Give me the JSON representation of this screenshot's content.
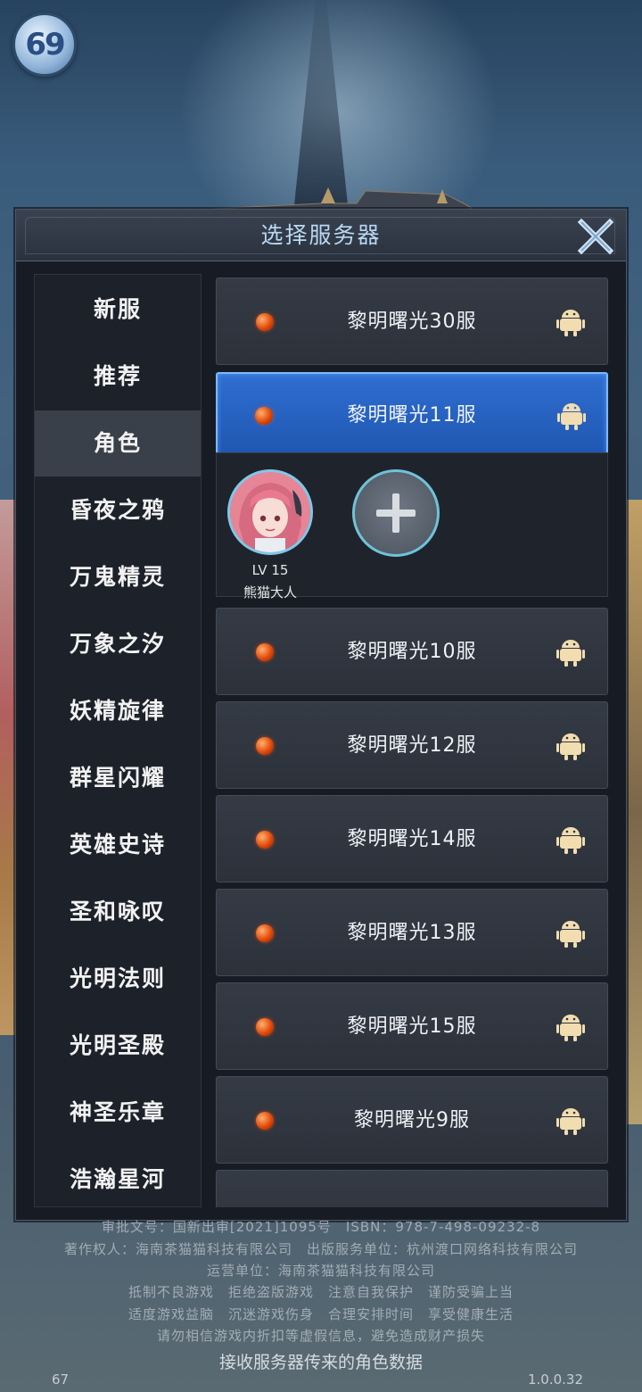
{
  "logo": {
    "text": "69"
  },
  "dialog": {
    "title": "选择服务器",
    "close_icon": "close-x-icon"
  },
  "sidebar": {
    "items": [
      {
        "label": "新服"
      },
      {
        "label": "推荐"
      },
      {
        "label": "角色",
        "active": true
      },
      {
        "label": "昏夜之鸦"
      },
      {
        "label": "万鬼精灵"
      },
      {
        "label": "万象之汐"
      },
      {
        "label": "妖精旋律"
      },
      {
        "label": "群星闪耀"
      },
      {
        "label": "英雄史诗"
      },
      {
        "label": "圣和咏叹"
      },
      {
        "label": "光明法则"
      },
      {
        "label": "光明圣殿"
      },
      {
        "label": "神圣乐章"
      },
      {
        "label": "浩瀚星河"
      }
    ]
  },
  "servers": [
    {
      "name": "黎明曙光30服",
      "status_color": "#e24a0a",
      "platform_icon": "android-icon"
    },
    {
      "name": "黎明曙光11服",
      "status_color": "#e24a0a",
      "platform_icon": "android-icon",
      "selected": true
    },
    {
      "name": "黎明曙光10服",
      "status_color": "#e24a0a",
      "platform_icon": "android-icon"
    },
    {
      "name": "黎明曙光12服",
      "status_color": "#e24a0a",
      "platform_icon": "android-icon"
    },
    {
      "name": "黎明曙光14服",
      "status_color": "#e24a0a",
      "platform_icon": "android-icon"
    },
    {
      "name": "黎明曙光13服",
      "status_color": "#e24a0a",
      "platform_icon": "android-icon"
    },
    {
      "name": "黎明曙光15服",
      "status_color": "#e24a0a",
      "platform_icon": "android-icon"
    },
    {
      "name": "黎明曙光9服",
      "status_color": "#e24a0a",
      "platform_icon": "android-icon"
    }
  ],
  "character": {
    "level": "LV 15",
    "name": "熊猫大人"
  },
  "footer": {
    "line1": "审批文号：国新出审[2021]1095号　ISBN：978-7-498-09232-8",
    "line2": "著作权人：海南茶猫猫科技有限公司　出版服务单位：杭州渡口网络科技有限公司",
    "line3": "运营单位：海南茶猫猫科技有限公司",
    "line4": "抵制不良游戏　拒绝盗版游戏　注意自我保护　谨防受骗上当",
    "line5": "适度游戏益脑　沉迷游戏伤身　合理安排时间　享受健康生活",
    "line6": "请勿相信游戏内折扣等虚假信息，避免造成财产损失",
    "status": "接收服务器传来的角色数据",
    "left_number": "67",
    "version": "1.0.0.32"
  },
  "colors": {
    "selected_row": "#2f6fd0",
    "title": "#b9d8f2",
    "status_dot": "#e24a0a"
  }
}
